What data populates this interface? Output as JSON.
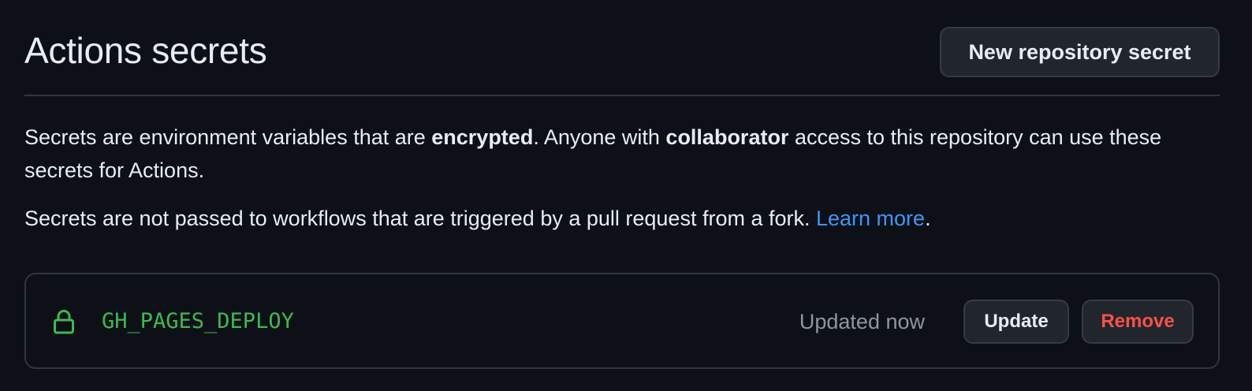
{
  "header": {
    "title": "Actions secrets",
    "new_secret_label": "New repository secret"
  },
  "description": {
    "p1_before_encrypted": "Secrets are environment variables that are ",
    "p1_encrypted": "encrypted",
    "p1_after_encrypted": ". Anyone with ",
    "p1_collaborator": "collaborator",
    "p1_after_collaborator": " access to this repository can use these secrets for Actions.",
    "p2_text": "Secrets are not passed to workflows that are triggered by a pull request from a fork. ",
    "p2_link": "Learn more",
    "p2_end": "."
  },
  "secrets": [
    {
      "icon": "lock-icon",
      "name": "GH_PAGES_DEPLOY",
      "updated": "Updated now",
      "update_label": "Update",
      "remove_label": "Remove"
    }
  ],
  "colors": {
    "background": "#0d1117",
    "text": "#e6edf3",
    "muted": "#8d96a0",
    "link": "#4493f8",
    "secret_name": "#3fb950",
    "danger": "#f85149",
    "border": "#30363d",
    "button_bg": "#21262d"
  }
}
